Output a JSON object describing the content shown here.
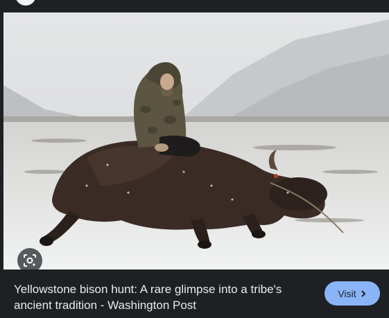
{
  "preview": {
    "caption": "Yellowstone bison hunt: A rare glimpse into a tribe's ancient tradition - Washington Post",
    "visit_label": "Visit",
    "visit_icon": "chevron-right-icon",
    "lens_icon": "google-lens-icon",
    "image_description_icon": "photo",
    "colors": {
      "background": "#1f2023",
      "accent": "#8ab4f8",
      "caption_text": "#e8eaed"
    }
  }
}
